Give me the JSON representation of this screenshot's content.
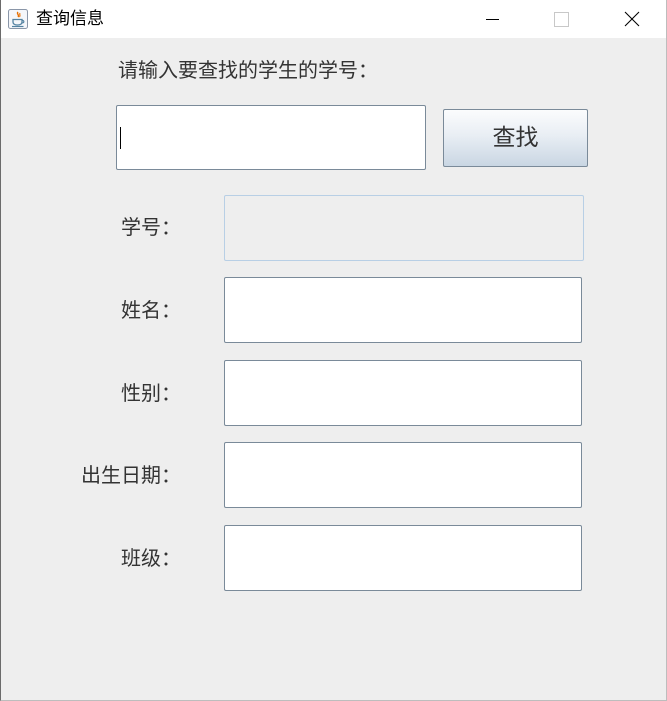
{
  "window": {
    "title": "查询信息",
    "minimize_icon": "minimize-icon",
    "maximize_icon": "maximize-icon",
    "close_icon": "close-icon"
  },
  "search": {
    "prompt": "请输入要查找的学生的学号：",
    "input_value": "",
    "button_label": "查找"
  },
  "fields": [
    {
      "label": "学号：",
      "value": "",
      "enabled": false
    },
    {
      "label": "姓名：",
      "value": "",
      "enabled": true
    },
    {
      "label": "性别：",
      "value": "",
      "enabled": true
    },
    {
      "label": "出生日期：",
      "value": "",
      "enabled": true
    },
    {
      "label": "班级：",
      "value": "",
      "enabled": true
    }
  ],
  "colors": {
    "background": "#eeeeee",
    "titlebar": "#ffffff",
    "input_border": "#7a8a99",
    "disabled_border": "#b8cfe5"
  }
}
